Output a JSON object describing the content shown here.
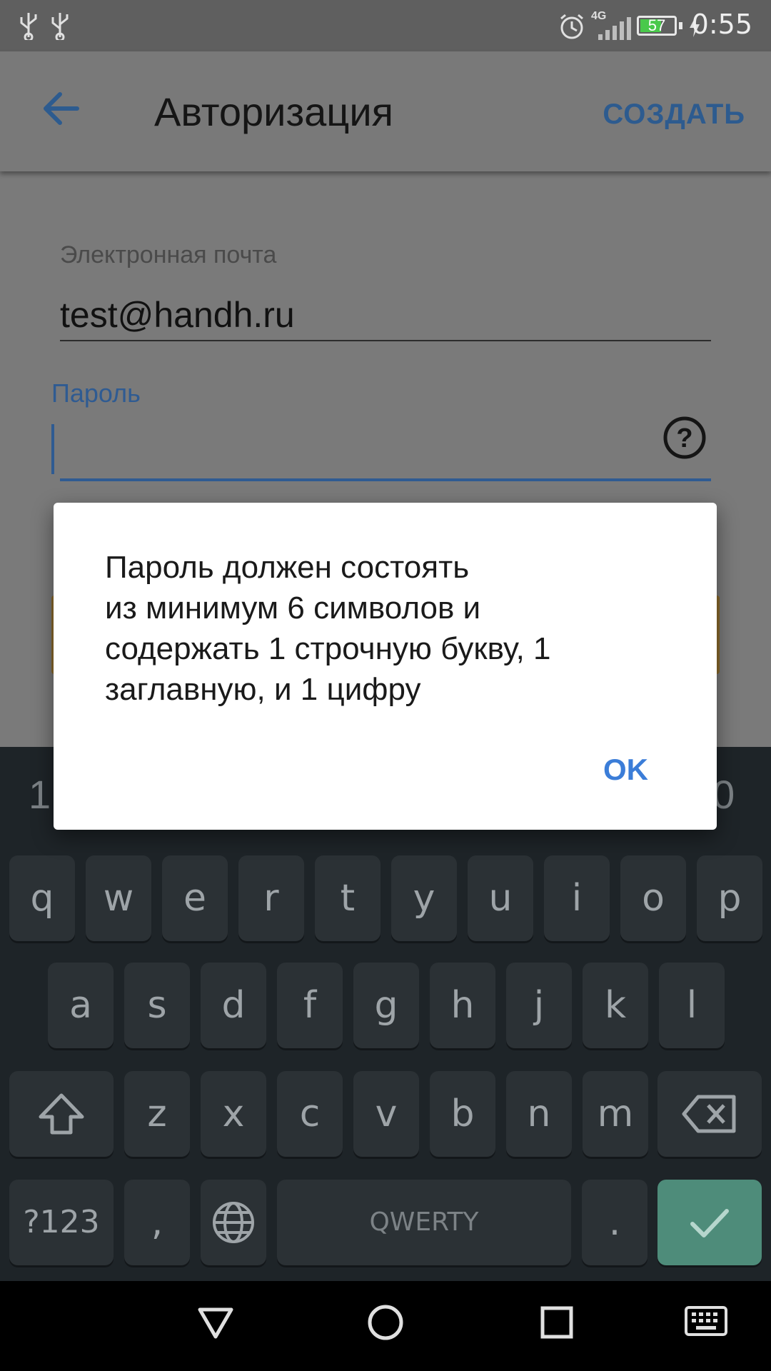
{
  "status_bar": {
    "time": "0:55",
    "battery_level": "57",
    "network": "4G",
    "icons": [
      "usb-icon",
      "usb-icon",
      "alarm-icon",
      "signal-icon",
      "battery-icon",
      "charging-icon"
    ]
  },
  "app_bar": {
    "title": "Авторизация",
    "action_label": "СОЗДАТЬ",
    "back_icon": "arrow-left-icon"
  },
  "form": {
    "email_label": "Электронная почта",
    "email_value": "test@handh.ru",
    "password_label": "Пароль",
    "password_value": "",
    "help_icon": "question-circle-icon"
  },
  "dialog": {
    "message_lines": [
      "Пароль должен состоять",
      "из минимум 6 символов и",
      "содержать 1 строчную букву, 1",
      "заглавную, и 1 цифру"
    ],
    "ok_label": "OK"
  },
  "keyboard": {
    "number_row_left": "1",
    "number_row_right": "0",
    "row1": [
      "q",
      "w",
      "e",
      "r",
      "t",
      "y",
      "u",
      "i",
      "o",
      "p"
    ],
    "row2": [
      "a",
      "s",
      "d",
      "f",
      "g",
      "h",
      "j",
      "k",
      "l"
    ],
    "row3": [
      "z",
      "x",
      "c",
      "v",
      "b",
      "n",
      "m"
    ],
    "symbols_label": "?123",
    "comma_label": ",",
    "space_label": "QWERTY",
    "period_label": ".",
    "shift_icon": "shift-icon",
    "backspace_icon": "backspace-icon",
    "globe_icon": "globe-icon",
    "enter_icon": "checkmark-icon",
    "accent_color": "#4e8c7a"
  },
  "nav_bar": {
    "icons": [
      "back-triangle-icon",
      "home-circle-icon",
      "recents-square-icon",
      "keyboard-icon"
    ]
  }
}
